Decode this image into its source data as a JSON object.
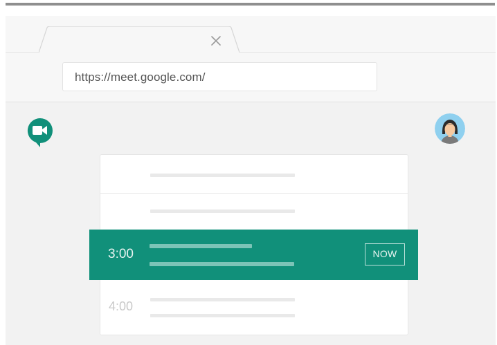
{
  "browser": {
    "tab_close_icon": "close-icon",
    "address": "https://meet.google.com/"
  },
  "app": {
    "logo_icon": "google-meet-icon",
    "avatar_icon": "user-avatar",
    "brand_color": "#11907a"
  },
  "schedule": {
    "active_time": "3:00",
    "active_badge": "NOW",
    "next_time": "4:00"
  }
}
